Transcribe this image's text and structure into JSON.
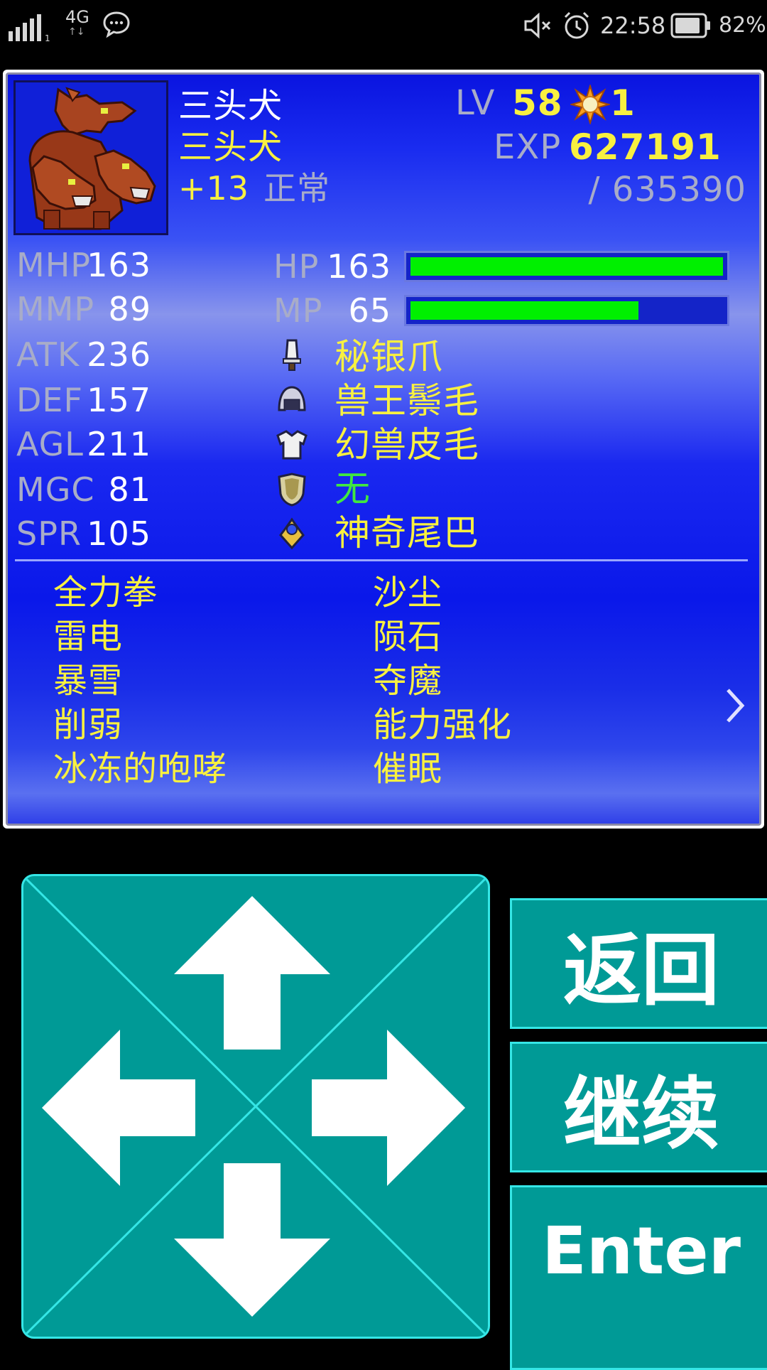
{
  "status_bar": {
    "network": "4G",
    "time": "22:58",
    "battery": "82%"
  },
  "character": {
    "name": "三头犬",
    "class": "三头犬",
    "plus": "+13",
    "condition": "正常",
    "level_label": "LV",
    "level": "58",
    "stars": "1",
    "exp_label": "EXP",
    "exp": "627191",
    "exp_next": "/ 635390"
  },
  "stats": [
    {
      "label": "MHP",
      "value": "163"
    },
    {
      "label": "MMP",
      "value": "89"
    },
    {
      "label": "ATK",
      "value": "236"
    },
    {
      "label": "DEF",
      "value": "157"
    },
    {
      "label": "AGL",
      "value": "211"
    },
    {
      "label": "MGC",
      "value": "81"
    },
    {
      "label": "SPR",
      "value": "105"
    }
  ],
  "gauges": [
    {
      "label": "HP",
      "value": "163",
      "fill": 1.0
    },
    {
      "label": "MP",
      "value": "65",
      "fill": 0.73
    }
  ],
  "equipment": [
    {
      "slot_icon": "dagger-icon",
      "name": "秘银爪",
      "color": "#f8f040"
    },
    {
      "slot_icon": "helmet-icon",
      "name": "兽王鬃毛",
      "color": "#f8f040"
    },
    {
      "slot_icon": "armor-icon",
      "name": "幻兽皮毛",
      "color": "#f8f040"
    },
    {
      "slot_icon": "shield-icon",
      "name": "无",
      "color": "#40e840"
    },
    {
      "slot_icon": "accessory-icon",
      "name": "神奇尾巴",
      "color": "#f8f040"
    }
  ],
  "skills_left": [
    "全力拳",
    "雷电",
    "暴雪",
    "削弱",
    "冰冻的咆哮"
  ],
  "skills_right": [
    "沙尘",
    "陨石",
    "夺魔",
    "能力强化",
    "催眠"
  ],
  "controls": {
    "back": "返回",
    "continue": "继续",
    "enter": "Enter"
  },
  "colors": {
    "accent_teal": "#009a96",
    "teal_border": "#35e6e6",
    "text_yellow": "#f8f040",
    "gauge_green": "#00f000"
  }
}
